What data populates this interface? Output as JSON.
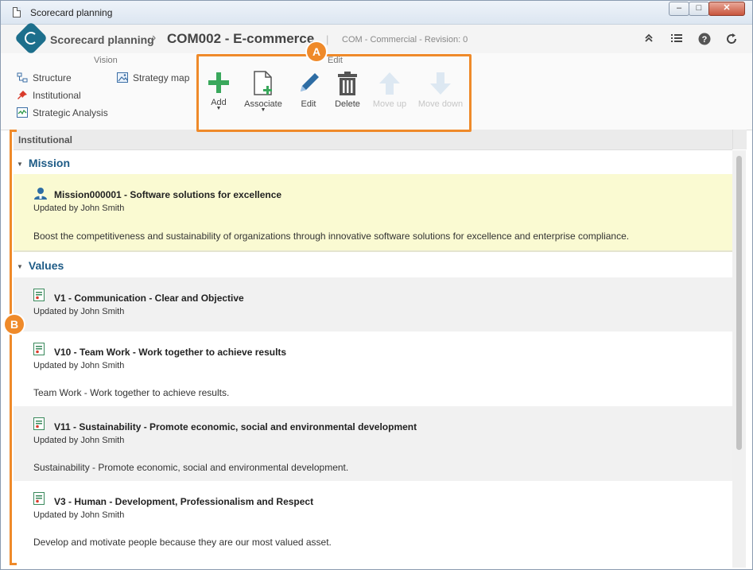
{
  "window": {
    "title": "Scorecard planning",
    "min_label": "‒",
    "max_label": "□",
    "close_label": "✕"
  },
  "header": {
    "app_name": "Scorecard planning",
    "separator": "›",
    "record_title": "COM002 - E-commerce",
    "pipe": "|",
    "subtitle": "COM - Commercial - Revision: 0"
  },
  "ribbon": {
    "vision_label": "Vision",
    "edit_label": "Edit",
    "vision_items": [
      {
        "label": "Structure",
        "icon": "structure-icon"
      },
      {
        "label": "Institutional",
        "icon": "pin-icon"
      },
      {
        "label": "Strategic Analysis",
        "icon": "chart-icon"
      },
      {
        "label": "Strategy map",
        "icon": "image-icon"
      }
    ],
    "buttons": [
      {
        "label": "Add",
        "icon": "plus-icon",
        "enabled": true,
        "has_dropdown": true
      },
      {
        "label": "Associate",
        "icon": "document-add-icon",
        "enabled": true,
        "has_dropdown": true
      },
      {
        "label": "Edit",
        "icon": "pencil-icon",
        "enabled": true,
        "has_dropdown": false
      },
      {
        "label": "Delete",
        "icon": "trash-icon",
        "enabled": true,
        "has_dropdown": false
      },
      {
        "label": "Move up",
        "icon": "arrow-up-icon",
        "enabled": false,
        "has_dropdown": false
      },
      {
        "label": "Move down",
        "icon": "arrow-down-icon",
        "enabled": false,
        "has_dropdown": false
      }
    ]
  },
  "section": {
    "title": "Institutional"
  },
  "mission": {
    "group_title": "Mission",
    "title": "Mission000001 - Software solutions for excellence",
    "updated_by": "Updated by John Smith",
    "description": "Boost the competitiveness and sustainability of organizations through innovative software solutions for excellence and enterprise compliance."
  },
  "values": {
    "group_title": "Values",
    "items": [
      {
        "title": "V1 - Communication - Clear and Objective",
        "updated_by": "Updated by John Smith",
        "description": ""
      },
      {
        "title": "V10 - Team Work - Work together to achieve results",
        "updated_by": "Updated by John Smith",
        "description": "Team Work - Work together to achieve results."
      },
      {
        "title": "V11 - Sustainability - Promote economic, social and environmental development",
        "updated_by": "Updated by John Smith",
        "description": "Sustainability - Promote economic, social and environmental development."
      },
      {
        "title": "V3 - Human - Development, Professionalism and Respect",
        "updated_by": "Updated by John Smith",
        "description": "Develop and motivate people because they are our most valued asset."
      }
    ]
  },
  "annotations": {
    "badge_a": "A",
    "badge_b": "B"
  },
  "colors": {
    "accent": "#ef8a2a",
    "brand": "#1d6f8c",
    "group_title": "#1e5b86",
    "add_green": "#3aa85c",
    "edit_blue": "#2e6da4"
  }
}
